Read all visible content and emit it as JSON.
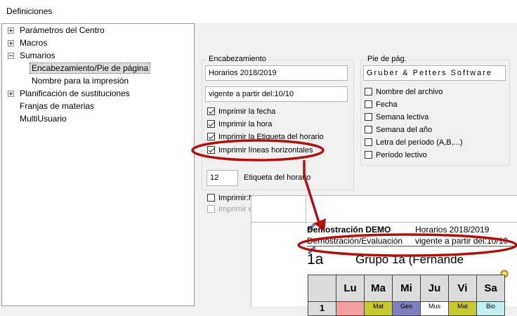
{
  "window": {
    "title": "Definiciones"
  },
  "tree": {
    "items": [
      {
        "label": "Parámetros del Centro",
        "expander": "plus"
      },
      {
        "label": "Macros",
        "expander": "plus"
      },
      {
        "label": "Sumarios",
        "expander": "minus"
      },
      {
        "label": "Encabezamiento/Pie de página",
        "selected": true
      },
      {
        "label": "Nombre para la impresión"
      },
      {
        "label": "Planificación de sustituciones",
        "expander": "plus"
      },
      {
        "label": "Franjas de materias"
      },
      {
        "label": "MultiUsuario"
      }
    ]
  },
  "header_group": {
    "title": "Encabezamiento",
    "line1": "Horarios 2018/2019",
    "line2": "vigente a partir del:10/10",
    "checks": [
      {
        "label": "Imprimir la fecha",
        "checked": true
      },
      {
        "label": "Imprimir la hora",
        "checked": true
      },
      {
        "label": "Imprimir la Etiqueta del horario",
        "checked": true
      },
      {
        "label": "Imprimir líneas horizontales",
        "checked": true
      }
    ],
    "font_size": "12",
    "font_label": "Etiqueta del horario"
  },
  "footer_group": {
    "title": "Pie de pág.",
    "text": "Gruber & Petters Software",
    "checks": [
      {
        "label": "Nombre del archivo",
        "checked": false
      },
      {
        "label": "Fecha",
        "checked": false
      },
      {
        "label": "Semana lectiva",
        "checked": false
      },
      {
        "label": "Semana del año",
        "checked": false
      },
      {
        "label": "Letra del período (A,B,...)",
        "checked": false
      },
      {
        "label": "Período lectivo",
        "checked": false
      }
    ]
  },
  "lower_checks": [
    {
      "label": "Imprimir:N",
      "checked": false
    },
    {
      "label": "Imprimir el",
      "checked": false,
      "disabled": true
    }
  ],
  "preview": {
    "left1": "Demostración  DEMO",
    "right1": "Horarios 2018/2019",
    "left2": "Demostración/Evaluación",
    "right2": "vigente a partir del:10/10",
    "class_code": "1a",
    "group_title": "Grupo 1a (Fernande",
    "days": [
      "Lu",
      "Ma",
      "Mi",
      "Ju",
      "Vi",
      "Sa"
    ],
    "row1_label": "1",
    "row1_cells": [
      "",
      "Mat",
      "Geo",
      "Mus",
      "Mat",
      "Bio"
    ],
    "colors": {
      "lu": "#f2a0a0",
      "ma": "#c8c830",
      "mi": "#8080c0",
      "ju": "#ffffff",
      "vi": "#c8c830",
      "sa": "#c0f0f0"
    }
  },
  "annotation": {
    "color": "#b01010"
  }
}
